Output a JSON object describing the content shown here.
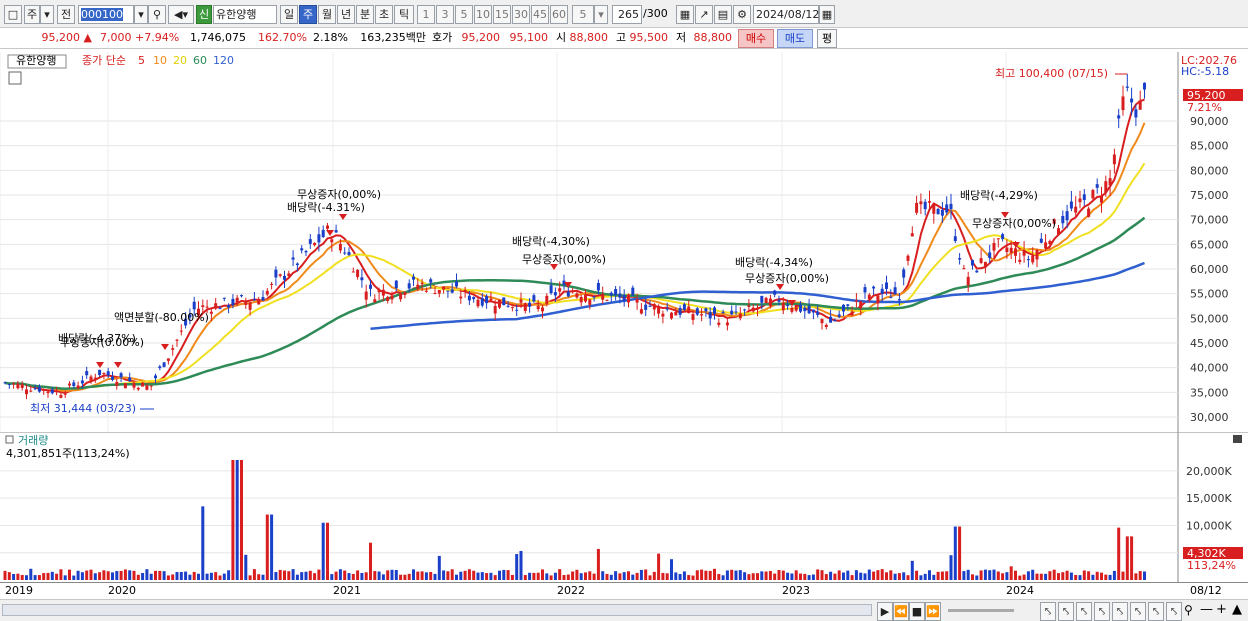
{
  "toolbar": {
    "period_label": "주",
    "prev_label": "전",
    "code_value": "000100",
    "stock_badge": "신",
    "stock_name": "유한양행",
    "tabs": [
      "일",
      "주",
      "월",
      "년",
      "분",
      "초",
      "틱"
    ],
    "selected_tab": "주",
    "intervals": [
      "1",
      "3",
      "5",
      "10",
      "15",
      "30",
      "45",
      "60"
    ],
    "interval_select": "5",
    "count_value": "265",
    "count_total": "/300",
    "date_value": "2024/08/12"
  },
  "quote": {
    "price": "95,200",
    "change": "7,000",
    "change_pct": "+7.94%",
    "volume": "1,746,075",
    "volume_ratio": "162.70%",
    "turnover": "2.18%",
    "amount": "163,235백만",
    "bid_label": "호가",
    "ask_price": "95,200",
    "bid_price": "95,100",
    "open_label": "시",
    "open": "88,800",
    "high_label": "고",
    "high": "95,500",
    "low_label": "저",
    "low": "88,800",
    "buy_button": "매수",
    "sell_button": "매도",
    "eval_button": "평"
  },
  "legend": {
    "stock": "유한양행",
    "price_label": "종가 단순",
    "ma_periods": [
      "5",
      "10",
      "20",
      "60",
      "120"
    ],
    "ma_colors": [
      "#d81e1e",
      "#f08a1a",
      "#f0e020",
      "#2e8b57",
      "#2f5fd0"
    ],
    "lc": "LC:202.76",
    "hc": "HC:-5.18"
  },
  "annotations": {
    "max_label": "최고 100,400 (07/15)",
    "min_label": "최저 31,444 (03/23)",
    "events": [
      "배당락(-4.37%)",
      "무상증자(0.00%)",
      "액면분할(-80.00%)",
      "무상증자(0,00%)",
      "배당락(-4.31%)",
      "배당락(-4,30%)",
      "무상증자(0,00%)",
      "배당락(-4,34%)",
      "무상증자(0,00%)",
      "배당락(-4,29%)",
      "무상증자(0,00%)"
    ]
  },
  "price_axis": {
    "ticks": [
      "90,000",
      "85,000",
      "80,000",
      "75,000",
      "70,000",
      "65,000",
      "60,000",
      "55,000",
      "50,000",
      "45,000",
      "40,000",
      "35,000",
      "30,000"
    ],
    "current_tag": "95,200",
    "current_pct": "7.21%"
  },
  "volume": {
    "title": "거래량",
    "info": "4,301,851주(113,24%)",
    "ticks": [
      "20,000K",
      "15,000K",
      "10,000K",
      "5,000K"
    ],
    "current_tag": "4,302K",
    "current_pct": "113,24%"
  },
  "x_axis": {
    "labels": [
      "2019",
      "2020",
      "2021",
      "2022",
      "2023",
      "2024"
    ],
    "right_label": "08/12"
  },
  "chart_data": {
    "type": "candlestick",
    "title": "",
    "ylim": [
      30000,
      102000
    ],
    "series": [
      {
        "name": "종가",
        "x": [
          "2019-01",
          "2019-07",
          "2020-01",
          "2020-04",
          "2020-07",
          "2020-10",
          "2021-01",
          "2021-04",
          "2021-07",
          "2022-01",
          "2022-07",
          "2023-01",
          "2023-04",
          "2023-07",
          "2023-10",
          "2024-01",
          "2024-04",
          "2024-07",
          "2024-08"
        ],
        "values": [
          37000,
          35000,
          39000,
          36000,
          52000,
          54000,
          64000,
          55000,
          57000,
          55000,
          52000,
          53000,
          52000,
          73000,
          60000,
          64000,
          75000,
          98000,
          95200
        ]
      }
    ],
    "volume_ylim": [
      0,
      22000
    ],
    "volume_unit": "K"
  }
}
